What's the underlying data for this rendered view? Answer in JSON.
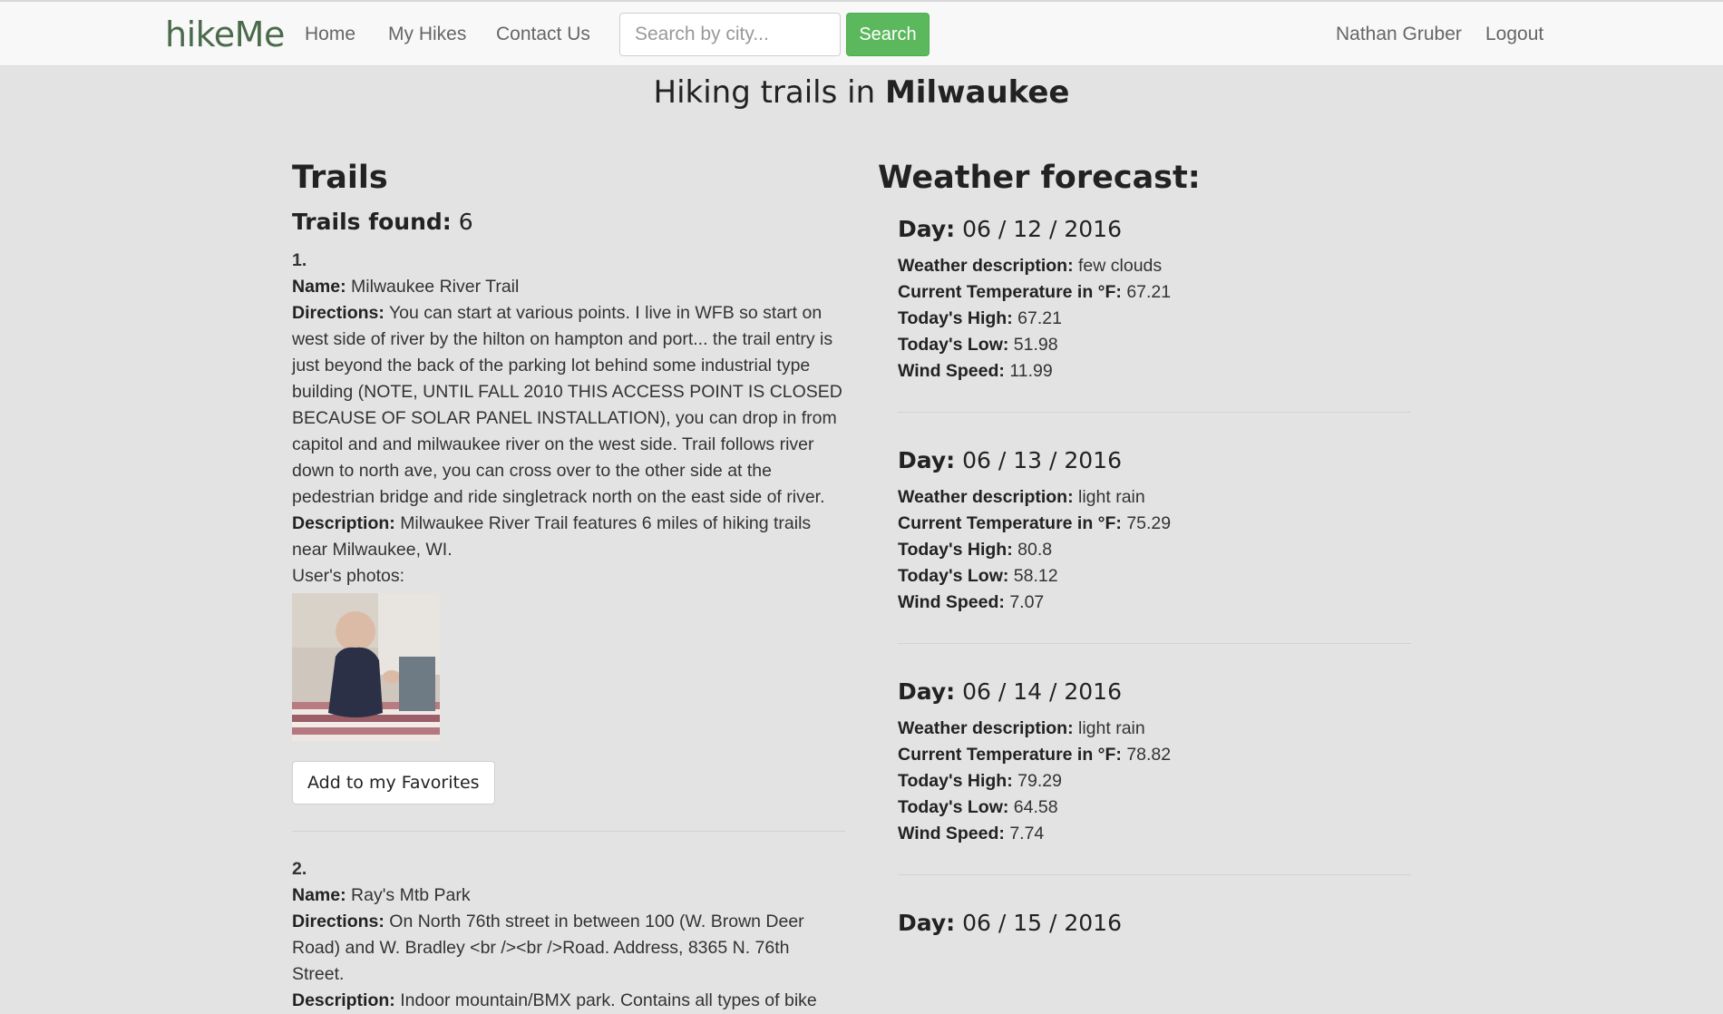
{
  "nav": {
    "brand": "hikeMe",
    "links": [
      "Home",
      "My Hikes",
      "Contact Us"
    ],
    "search_placeholder": "Search by city...",
    "search_button": "Search",
    "user": "Nathan Gruber",
    "logout": "Logout"
  },
  "page": {
    "title_prefix": "Hiking trails in",
    "city": "Milwaukee"
  },
  "trails": {
    "heading": "Trails",
    "found_label": "Trails found:",
    "found_count": "6",
    "items": [
      {
        "num": "1.",
        "name_label": "Name:",
        "name": "Milwaukee River Trail",
        "directions_label": "Directions:",
        "directions": "You can start at various points. I live in WFB so start on west side of river by the hilton on hampton and port... the trail entry is just beyond the back of the parking lot behind some industrial type building (NOTE, UNTIL FALL 2010 THIS ACCESS POINT IS CLOSED BECAUSE OF SOLAR PANEL INSTALLATION), you can drop in from capitol and and milwaukee river on the west side. Trail follows river down to north ave, you can cross over to the other side at the pedestrian bridge and ride singletrack north on the east side of river.",
        "description_label": "Description:",
        "description": "Milwaukee River Trail features 6 miles of hiking trails near Milwaukee, WI.",
        "photos_label": "User's photos:",
        "favorite_button": "Add to my Favorites"
      },
      {
        "num": "2.",
        "name_label": "Name:",
        "name": "Ray's Mtb Park",
        "directions_label": "Directions:",
        "directions": "On North 76th street in between 100 (W. Brown Deer Road) and W. Bradley <br /><br />Road. Address, 8365 N. 76th Street.",
        "description_label": "Description:",
        "description": "Indoor mountain/BMX park. Contains all types of bike"
      }
    ]
  },
  "weather": {
    "heading": "Weather forecast:",
    "day_label": "Day:",
    "desc_label": "Weather description:",
    "temp_label": "Current Temperature in °F:",
    "high_label": "Today's High:",
    "low_label": "Today's Low:",
    "wind_label": "Wind Speed:",
    "days": [
      {
        "date": "06 / 12 / 2016",
        "desc": "few clouds",
        "temp": "67.21",
        "high": "67.21",
        "low": "51.98",
        "wind": "11.99"
      },
      {
        "date": "06 / 13 / 2016",
        "desc": "light rain",
        "temp": "75.29",
        "high": "80.8",
        "low": "58.12",
        "wind": "7.07"
      },
      {
        "date": "06 / 14 / 2016",
        "desc": "light rain",
        "temp": "78.82",
        "high": "79.29",
        "low": "64.58",
        "wind": "7.74"
      },
      {
        "date": "06 / 15 / 2016"
      }
    ]
  }
}
